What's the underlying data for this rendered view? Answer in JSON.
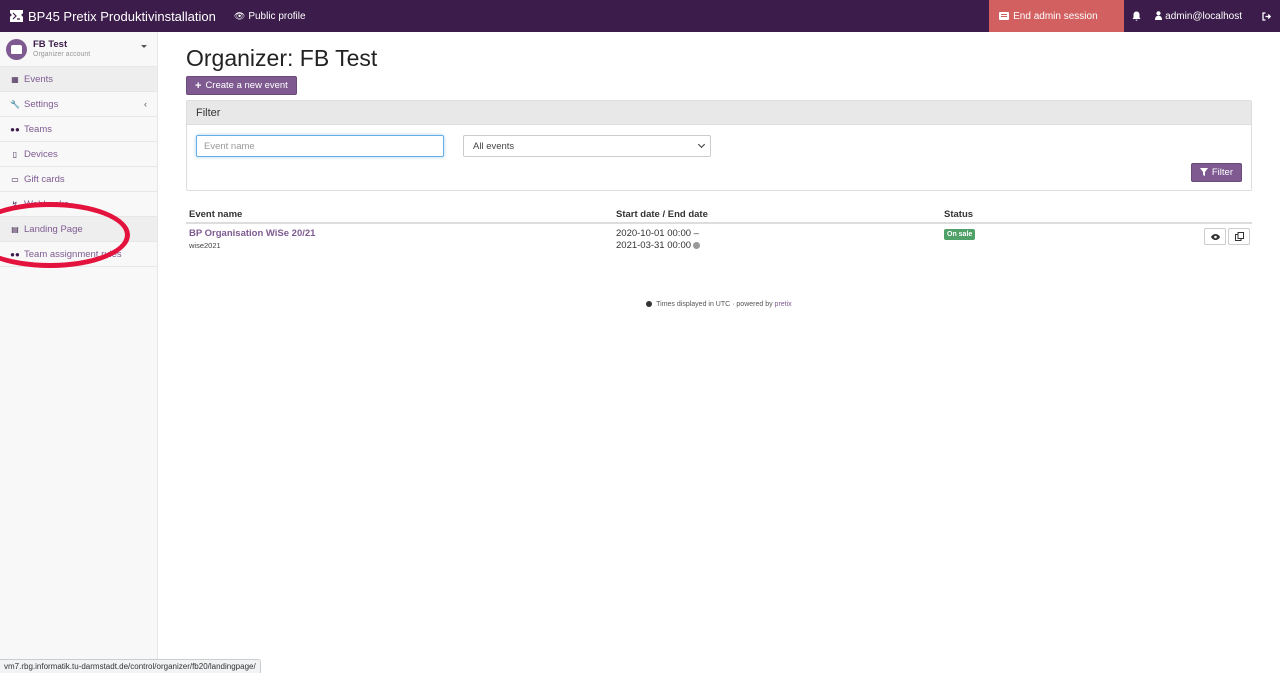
{
  "topbar": {
    "brand": "BP45 Pretix Produktivinstallation",
    "public_profile": "Public profile",
    "end_admin": "End admin session",
    "user": "admin@localhost",
    "colors": {
      "bg": "#3b1c4a",
      "end_admin_bg": "#d36060"
    }
  },
  "sidebar": {
    "org_name": "FB Test",
    "org_subtitle": "Organizer account",
    "items": [
      {
        "label": "Events",
        "icon": "calendar-icon",
        "active": true
      },
      {
        "label": "Settings",
        "icon": "wrench-icon",
        "chevron": "‹"
      },
      {
        "label": "Teams",
        "icon": "group-icon"
      },
      {
        "label": "Devices",
        "icon": "tablet-icon"
      },
      {
        "label": "Gift cards",
        "icon": "credit-card-icon"
      },
      {
        "label": "Webhooks",
        "icon": "webhook-icon"
      },
      {
        "label": "Landing Page",
        "icon": "file-icon"
      },
      {
        "label": "Team assignment rules",
        "icon": "group-icon"
      }
    ]
  },
  "main": {
    "title": "Organizer: FB Test",
    "create_button": "Create a new event",
    "filter": {
      "heading": "Filter",
      "event_name_placeholder": "Event name",
      "select_value": "All events",
      "button": "Filter"
    },
    "table": {
      "headers": [
        "Event name",
        "Start date / End date",
        "Status"
      ],
      "rows": [
        {
          "name": "BP Organisation WiSe 20/21",
          "slug": "wise2021",
          "start": "2020-10-01 00:00 –",
          "end": "2021-03-31 00:00",
          "status": "On sale"
        }
      ]
    },
    "footer": {
      "text": "Times displayed in UTC · powered by",
      "link": "pretix"
    }
  },
  "statusbar": {
    "url": "vm7.rbg.informatik.tu-darmstadt.de/control/organizer/fb20/landingpage/"
  },
  "accent_color": "#7f5a91",
  "annotation_color": "#e3133d"
}
